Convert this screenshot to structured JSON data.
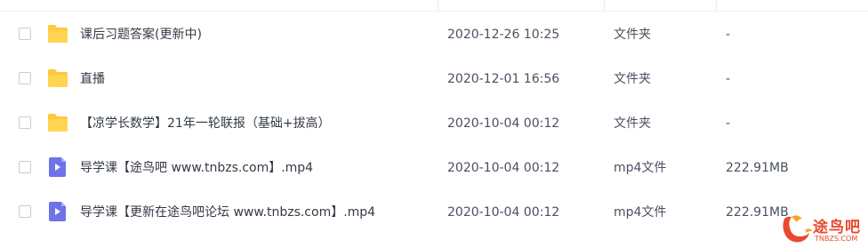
{
  "colors": {
    "folder": "#ffc83d",
    "video_icon": "#6f72e8",
    "watermark": "#e8492f"
  },
  "files": [
    {
      "name": "课后习题答案(更新中)",
      "modified": "2020-12-26 10:25",
      "type": "文件夹",
      "size": "-",
      "icon": "folder-icon"
    },
    {
      "name": "直播",
      "modified": "2020-12-01 16:56",
      "type": "文件夹",
      "size": "-",
      "icon": "folder-icon"
    },
    {
      "name": "【凉学长数学】21年一轮联报（基础+拔高）",
      "modified": "2020-10-04 00:12",
      "type": "文件夹",
      "size": "-",
      "icon": "folder-icon"
    },
    {
      "name": "导学课【途鸟吧 www.tnbzs.com】.mp4",
      "modified": "2020-10-04 00:12",
      "type": "mp4文件",
      "size": "222.91MB",
      "icon": "video-file-icon"
    },
    {
      "name": "导学课【更新在途鸟吧论坛 www.tnbzs.com】.mp4",
      "modified": "2020-10-04 00:12",
      "type": "mp4文件",
      "size": "222.91MB",
      "icon": "video-file-icon"
    }
  ],
  "watermark": {
    "text": "途鸟吧",
    "url": "TNBZS.COM"
  }
}
